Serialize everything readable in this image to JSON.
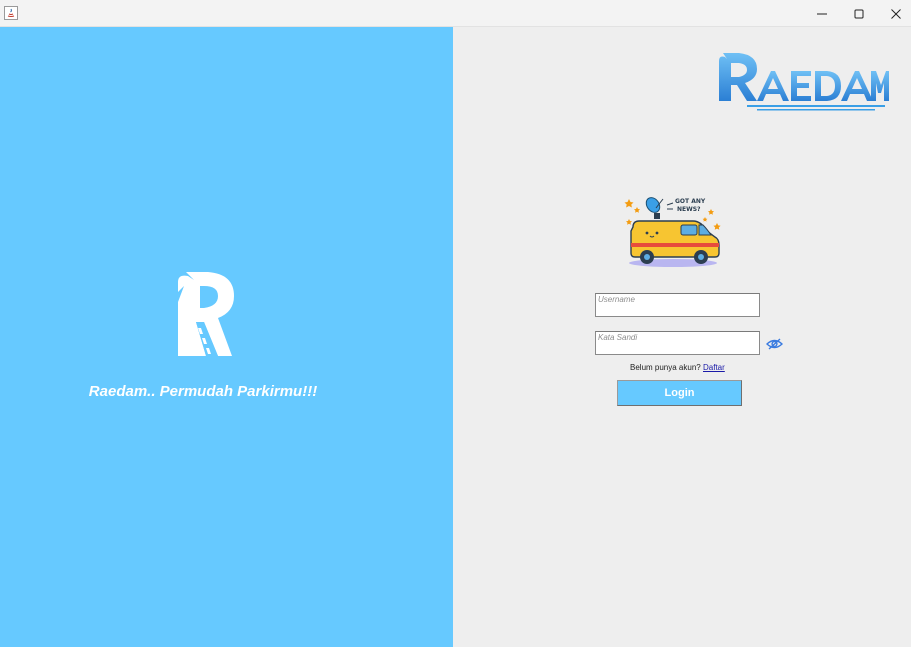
{
  "window": {
    "icons": {
      "app": "java-app-icon",
      "minimize": "minimize-icon",
      "maximize": "maximize-icon",
      "close": "close-icon"
    }
  },
  "left_panel": {
    "logo_icon": "r-road-logo-icon",
    "tagline": "Raedam.. Permudah Parkirmu!!!",
    "background": "#66c9ff"
  },
  "right_panel": {
    "brand_logo": "raedam-brand-logo",
    "illustration": "news-van-illustration",
    "form": {
      "username": {
        "placeholder": "Username",
        "value": ""
      },
      "password": {
        "placeholder": "Kata Sandi",
        "value": ""
      },
      "show_password_icon": "eye-icon",
      "signup_prompt": "Belum punya akun?",
      "signup_link": "Daftar",
      "login_label": "Login"
    }
  },
  "colors": {
    "accent": "#66c9ff",
    "brand_blue": "#3a9fe6",
    "link": "#1a1aa8"
  }
}
